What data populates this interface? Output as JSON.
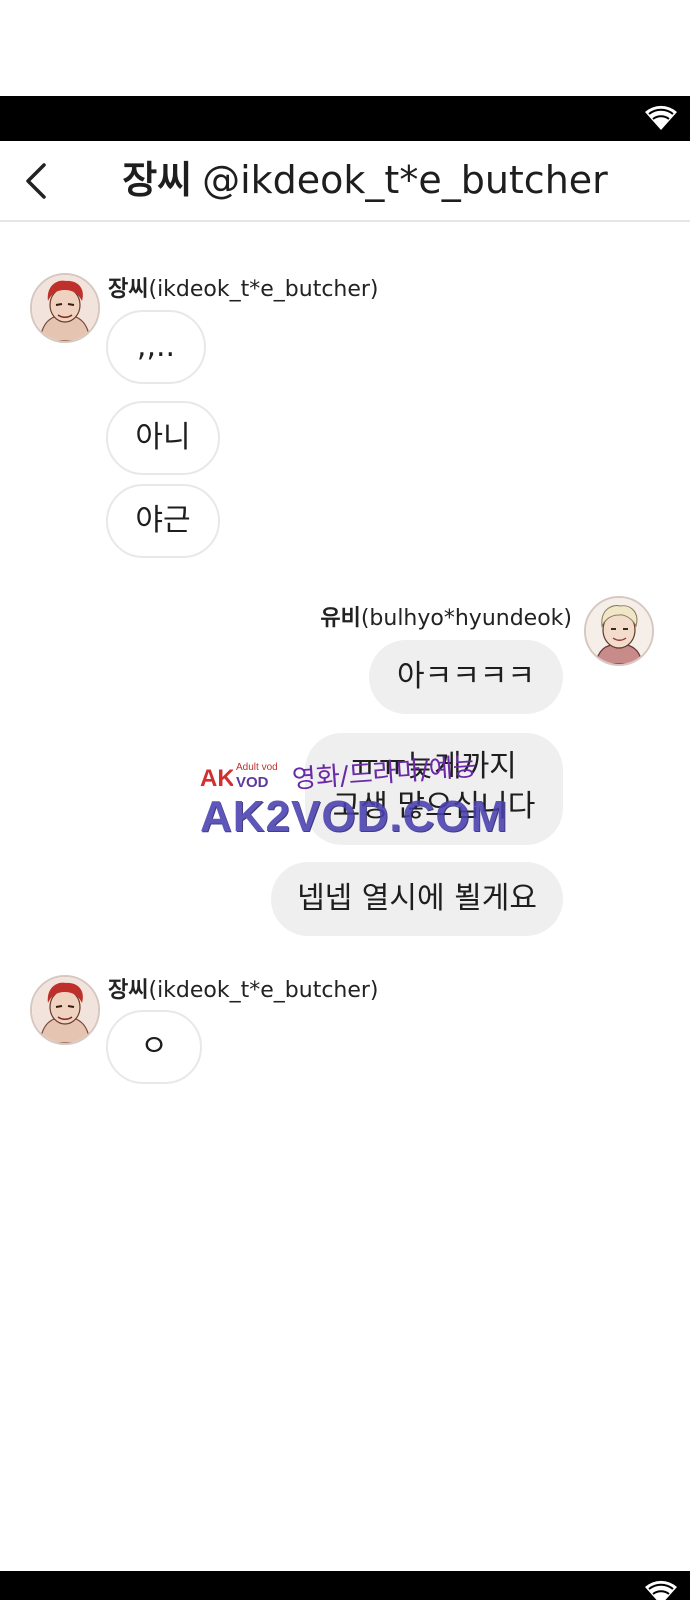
{
  "header": {
    "name": "장씨",
    "handle": "@ikdeok_t*e_butcher"
  },
  "messages": [
    {
      "sender_name": "장씨",
      "sender_handle": "(ikdeok_t*e_butcher)",
      "bubbles": [
        ",,..",
        "아니",
        "야근"
      ]
    },
    {
      "sender_name": "유비",
      "sender_handle": "(bulhyo*hyundeok)",
      "bubbles": [
        "아ㅋㅋㅋㅋ",
        "ㅠㅠ늦게까지\n고생 많으십니다",
        "넵넵 열시에 뵐게요"
      ]
    },
    {
      "sender_name": "장씨",
      "sender_handle": "(ikdeok_t*e_butcher)",
      "bubbles": [
        "ㅇ"
      ]
    }
  ],
  "watermark": {
    "logo": "AK",
    "small_text": "Adult vod",
    "vod_text": "VOD",
    "korean_text": "영화/드라마/예능",
    "domain": "AK2VOD.COM"
  },
  "colors": {
    "bar": "#000000",
    "incoming_bubble": "#ffffff",
    "outgoing_bubble": "#efefef",
    "avatar_hair": "#c0302a"
  },
  "icons": {
    "back": "chevron-left-icon",
    "status": "wifi-icon"
  }
}
